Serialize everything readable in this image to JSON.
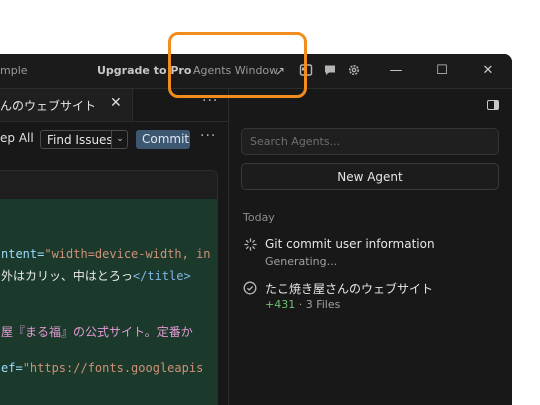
{
  "titlebar": {
    "title_fragment": "mple",
    "upgrade_label": "Upgrade to Pro",
    "agents_window_label": "Agents Window",
    "external_icon": "arrow-up-right-icon",
    "layout_icon": "layout-icon",
    "chat_icon": "chat-bubble-icon",
    "settings_icon": "gear-icon",
    "minimize_glyph": "—",
    "maximize_glyph": "☐",
    "close_glyph": "✕"
  },
  "editor_tab": {
    "label": "んのウェブサイト",
    "close_glyph": "✕",
    "more_glyph": "···"
  },
  "toolbar": {
    "step_all_label": "ep All",
    "find_issues_label": "Find Issues",
    "find_issues_chevron": "⌄",
    "commit_label": "Commit",
    "more_glyph": "···"
  },
  "code": {
    "line1_attr": "ntent=",
    "line1_str": "\"width=device-width, in",
    "line2_text": "外はカリッ、中はとろっ",
    "line2_tag": "</title>",
    "line3_text": "屋『まる福』の公式サイト。定番か",
    "line4_attr": "ef=",
    "line4_str": "\"https://fonts.googleapis"
  },
  "agents_panel": {
    "search_placeholder": "Search Agents...",
    "new_agent_label": "New Agent",
    "section_today": "Today",
    "agents": [
      {
        "title": "Git commit user information",
        "subtitle": "Generating...",
        "icon": "spinner-icon"
      },
      {
        "title": "たこ焼き屋さんのウェブサイト",
        "additions": "+431",
        "files": " · 3 Files",
        "icon": "check-circle-icon"
      }
    ]
  },
  "colors": {
    "highlight": "#f28c1c",
    "background": "#181818",
    "diff_added": "#1b3a2b",
    "commit_button": "#3e5770",
    "additions": "#6fbf73"
  }
}
